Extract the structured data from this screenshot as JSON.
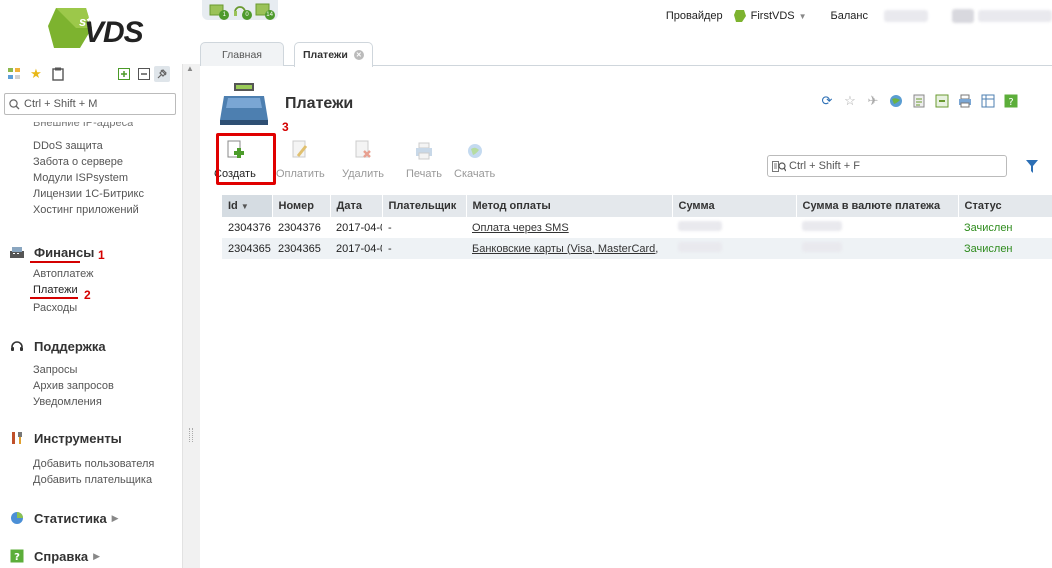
{
  "logo": {
    "sup": "st",
    "text": "VDS"
  },
  "sidebar": {
    "search_placeholder": "Ctrl + Shift + M",
    "cut_item": "Внешние IP-адреса",
    "items_top": [
      "DDoS защита",
      "Забота о сервере",
      "Модули ISPsystem",
      "Лицензии 1С-Битрикс",
      "Хостинг приложений"
    ],
    "sections": [
      {
        "label": "Финансы",
        "items": [
          "Автоплатеж",
          "Платежи",
          "Расходы"
        ]
      },
      {
        "label": "Поддержка",
        "items": [
          "Запросы",
          "Архив запросов",
          "Уведомления"
        ]
      },
      {
        "label": "Инструменты",
        "items": [
          "Добавить пользователя",
          "Добавить плательщика"
        ]
      },
      {
        "label": "Статистика"
      },
      {
        "label": "Справка"
      }
    ],
    "marks": {
      "finance": "1",
      "payments": "2"
    }
  },
  "top": {
    "badges": [
      "1",
      "0",
      "14"
    ],
    "provider_label": "Провайдер",
    "provider_name": "FirstVDS",
    "balance_label": "Баланс"
  },
  "tabs": [
    {
      "label": "Главная"
    },
    {
      "label": "Платежи"
    }
  ],
  "page": {
    "title": "Платежи"
  },
  "toolbar": {
    "create": "Создать",
    "pay": "Оплатить",
    "delete": "Удалить",
    "print": "Печать",
    "download": "Скачать",
    "mark": "3",
    "search_placeholder": "Ctrl + Shift + F"
  },
  "table": {
    "columns": [
      "Id",
      "Номер",
      "Дата",
      "Плательщик",
      "Метод оплаты",
      "Сумма",
      "Сумма в валюте платежа",
      "Статус"
    ],
    "rows": [
      {
        "id": "2304376",
        "number": "2304376",
        "date": "2017-04-0",
        "payer": "-",
        "method": "Оплата через SMS",
        "status": "Зачислен"
      },
      {
        "id": "2304365",
        "number": "2304365",
        "date": "2017-04-0",
        "payer": "-",
        "method": "Банковские карты (Visa, MasterCard,",
        "status": "Зачислен"
      }
    ]
  },
  "colors": {
    "accent_red": "#d40000",
    "status_green": "#2f8c1e",
    "logo_green": "#7db32f"
  }
}
